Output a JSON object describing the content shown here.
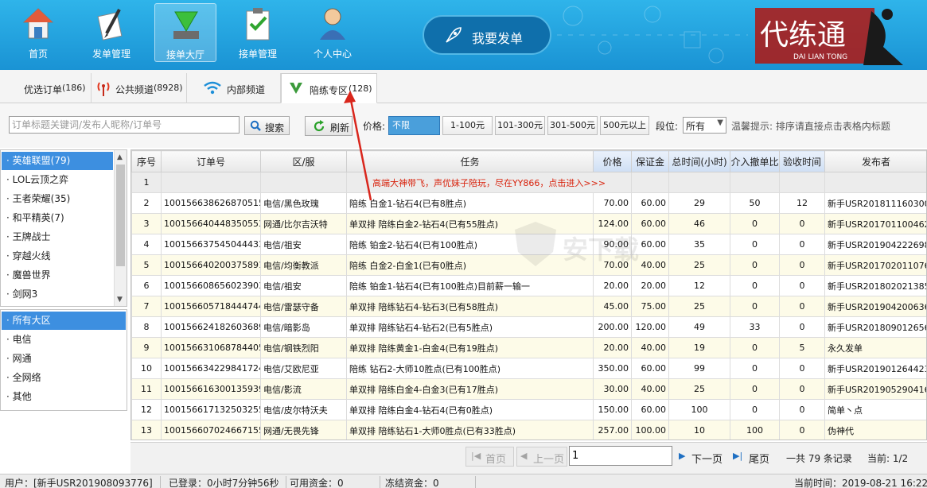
{
  "nav": {
    "items": [
      {
        "label": "首页",
        "icon": "home-icon"
      },
      {
        "label": "发单管理",
        "icon": "pen-paper-icon"
      },
      {
        "label": "接单大厅",
        "icon": "download-arrow-icon"
      },
      {
        "label": "接单管理",
        "icon": "clipboard-check-icon"
      },
      {
        "label": "个人中心",
        "icon": "user-icon"
      }
    ],
    "post_order": "我要发单",
    "logo_text": "代练通",
    "logo_subtext": "DAI LIAN TONG"
  },
  "tabs": [
    {
      "label": "优选订单",
      "count": "(186)"
    },
    {
      "label": "公共频道",
      "count": "(8928)"
    },
    {
      "label": "内部频道",
      "count": ""
    },
    {
      "label": "陪练专区",
      "count": "(128)"
    }
  ],
  "filter": {
    "search_placeholder": "订单标题关键词/发布人昵称/订单号",
    "search_label": "搜索",
    "refresh_label": "刷新",
    "price_label": "价格:",
    "price_options": [
      "不限",
      "1-100元",
      "101-300元",
      "301-500元",
      "500元以上"
    ],
    "rank_label": "段位:",
    "rank_value": "所有",
    "hint": "温馨提示: 排序请直接点击表格内标题"
  },
  "games": [
    "英雄联盟(79)",
    "LOL云顶之弈",
    "王者荣耀(35)",
    "和平精英(7)",
    "王牌战士",
    "穿越火线",
    "魔兽世界",
    "剑网3"
  ],
  "regions": [
    "所有大区",
    "电信",
    "网通",
    "全网络",
    "其他"
  ],
  "table": {
    "headers": [
      "序号",
      "订单号",
      "区/服",
      "任务",
      "价格",
      "保证金",
      "总时间(小时)",
      "介入撤单比",
      "验收时间",
      "发布者"
    ],
    "ad": "高端大神带飞，声优妹子陪玩，尽在YY866，点击进入>>>",
    "rows": [
      [
        "2",
        "10015663862687051508",
        "电信/黑色玫瑰",
        "陪练 白金1-钻石4(已有8胜点)",
        "70.00",
        "60.00",
        "29",
        "50",
        "12",
        "新手USR201811160300"
      ],
      [
        "3",
        "10015664044835055386",
        "网通/比尔吉沃特",
        "单双排 陪练白金2-钻石4(已有55胜点)",
        "124.00",
        "60.00",
        "46",
        "0",
        "0",
        "新手USR201701100462"
      ],
      [
        "4",
        "10015663754504443382",
        "电信/祖安",
        "陪练 铂金2-钻石4(已有100胜点)",
        "90.00",
        "60.00",
        "35",
        "0",
        "0",
        "新手USR201904222698"
      ],
      [
        "5",
        "10015664020037589152",
        "电信/均衡教派",
        "陪练 白金2-白金1(已有0胜点)",
        "70.00",
        "40.00",
        "25",
        "0",
        "0",
        "新手USR201702011076"
      ],
      [
        "6",
        "10015660865602390318",
        "电信/祖安",
        "陪练 铂金1-钻石4(已有100胜点)目前薪一输一",
        "20.00",
        "20.00",
        "12",
        "0",
        "0",
        "新手USR201802021385"
      ],
      [
        "7",
        "10015660571844474457",
        "电信/雷瑟守备",
        "单双排 陪练钻石4-钻石3(已有58胜点)",
        "45.00",
        "75.00",
        "25",
        "0",
        "0",
        "新手USR201904200636"
      ],
      [
        "8",
        "10015662418260368947",
        "电信/暗影岛",
        "单双排 陪练钻石4-钻石2(已有5胜点)",
        "200.00",
        "120.00",
        "49",
        "33",
        "0",
        "新手USR201809012656"
      ],
      [
        "9",
        "10015663106878440582",
        "电信/钢铁烈阳",
        "单双排 陪练黄金1-白金4(已有19胜点)",
        "20.00",
        "40.00",
        "19",
        "0",
        "5",
        "永久发单"
      ],
      [
        "10",
        "10015663422984172413",
        "电信/艾欧尼亚",
        "陪练 钻石2-大师10胜点(已有100胜点)",
        "350.00",
        "60.00",
        "99",
        "0",
        "0",
        "新手USR201901264423"
      ],
      [
        "11",
        "10015661630013593918",
        "电信/影流",
        "单双排 陪练白金4-白金3(已有17胜点)",
        "30.00",
        "40.00",
        "25",
        "0",
        "0",
        "新手USR201905290416"
      ],
      [
        "12",
        "10015661713250325597",
        "电信/皮尔特沃夫",
        "单双排 陪练白金4-钻石4(已有0胜点)",
        "150.00",
        "60.00",
        "100",
        "0",
        "0",
        "简单丶点"
      ],
      [
        "13",
        "10015660702466715578",
        "网通/无畏先锋",
        "单双排 陪练钻石1-大师0胜点(已有33胜点)",
        "257.00",
        "100.00",
        "10",
        "100",
        "0",
        "伪神代"
      ]
    ]
  },
  "pager": {
    "first": "首页",
    "prev": "上一页",
    "page_value": "1",
    "next": "下一页",
    "last": "尾页",
    "total": "一共 79 条记录",
    "current": "当前: 1/2"
  },
  "status": {
    "user": "用户：[新手USR201908093776]",
    "login": "已登录：0小时7分钟56秒",
    "funds": "可用资金：0",
    "frozen": "冻结资金：0",
    "time": "当前时间：2019-08-21 16:22:"
  },
  "watermark": "安下载",
  "colors": {
    "toolbar": "#1fa2df",
    "selection": "#3d8fe0",
    "annotation": "#d9261c"
  }
}
